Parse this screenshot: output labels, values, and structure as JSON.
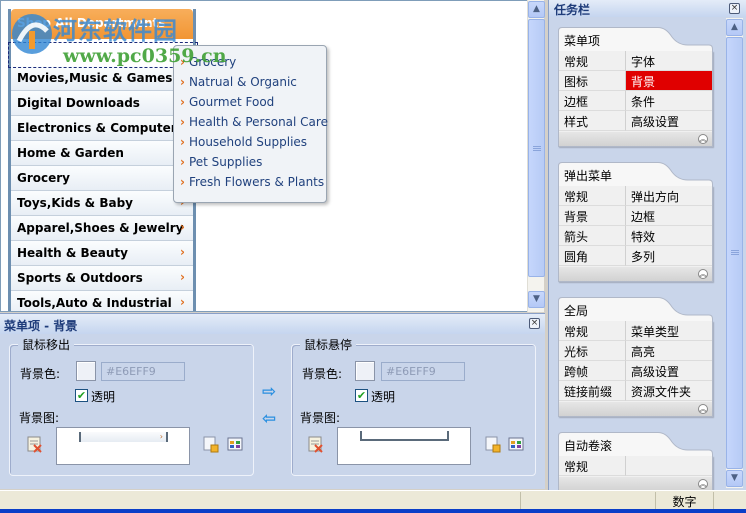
{
  "preview": {
    "menu": {
      "header": "Shop All Departments",
      "items": [
        {
          "label": "Movies,Music & Games"
        },
        {
          "label": "Digital Downloads"
        },
        {
          "label": "Electronics & Computers"
        },
        {
          "label": "Home & Garden"
        },
        {
          "label": "Grocery"
        },
        {
          "label": "Toys,Kids & Baby"
        },
        {
          "label": "Apparel,Shoes & Jewelry"
        },
        {
          "label": "Health & Beauty"
        },
        {
          "label": "Sports & Outdoors"
        },
        {
          "label": "Tools,Auto & Industrial"
        }
      ],
      "arrow_glyph": "›"
    },
    "popup": {
      "items": [
        {
          "label": "Grocery"
        },
        {
          "label": "Natrual & Organic"
        },
        {
          "label": "Gourmet Food"
        },
        {
          "label": "Health & Personal Care"
        },
        {
          "label": "Household Supplies"
        },
        {
          "label": "Pet Supplies"
        },
        {
          "label": "Fresh Flowers & Plants"
        }
      ],
      "arrow_glyph": "›"
    },
    "watermark": {
      "title": "河东软件园",
      "url": "www.pc0359.cn"
    }
  },
  "props": {
    "title": "菜单项 - 背景",
    "close_glyph": "×",
    "groups": [
      {
        "legend": "鼠标移出",
        "bg_color_label": "背景色:",
        "bg_color_value": "#E6EFF9",
        "transparent_label": "透明",
        "transparent_checked": true,
        "bg_image_label": "背景图:"
      },
      {
        "legend": "鼠标悬停",
        "bg_color_label": "背景色:",
        "bg_color_value": "#E6EFF9",
        "transparent_label": "透明",
        "transparent_checked": true,
        "bg_image_label": "背景图:"
      }
    ],
    "copy_right_glyph": "⇨",
    "copy_left_glyph": "⇦",
    "check_glyph": "✔"
  },
  "taskpane": {
    "title": "任务栏",
    "close_glyph": "×",
    "collapse_glyph": "︽",
    "cards": [
      {
        "title": "菜单项",
        "rows": [
          [
            "常规",
            "字体"
          ],
          [
            "图标",
            "背景"
          ],
          [
            "边框",
            "条件"
          ],
          [
            "样式",
            "高级设置"
          ]
        ],
        "selected": [
          1,
          1
        ]
      },
      {
        "title": "弹出菜单",
        "rows": [
          [
            "常规",
            "弹出方向"
          ],
          [
            "背景",
            "边框"
          ],
          [
            "箭头",
            "特效"
          ],
          [
            "圆角",
            "多列"
          ]
        ]
      },
      {
        "title": "全局",
        "rows": [
          [
            "常规",
            "菜单类型"
          ],
          [
            "光标",
            "高亮"
          ],
          [
            "跨帧",
            "高级设置"
          ],
          [
            "链接前缀",
            "资源文件夹"
          ]
        ]
      },
      {
        "title": "自动卷滚",
        "rows": [
          [
            "常规",
            ""
          ]
        ]
      }
    ]
  },
  "statusbar": {
    "num_indicator": "数字"
  },
  "colors": {
    "selected_cell": "#e00000",
    "menu_header": "#f08a1e",
    "popup_text": "#21427e",
    "arrow": "#e07020",
    "panel_bg": "#c9d5ea"
  }
}
